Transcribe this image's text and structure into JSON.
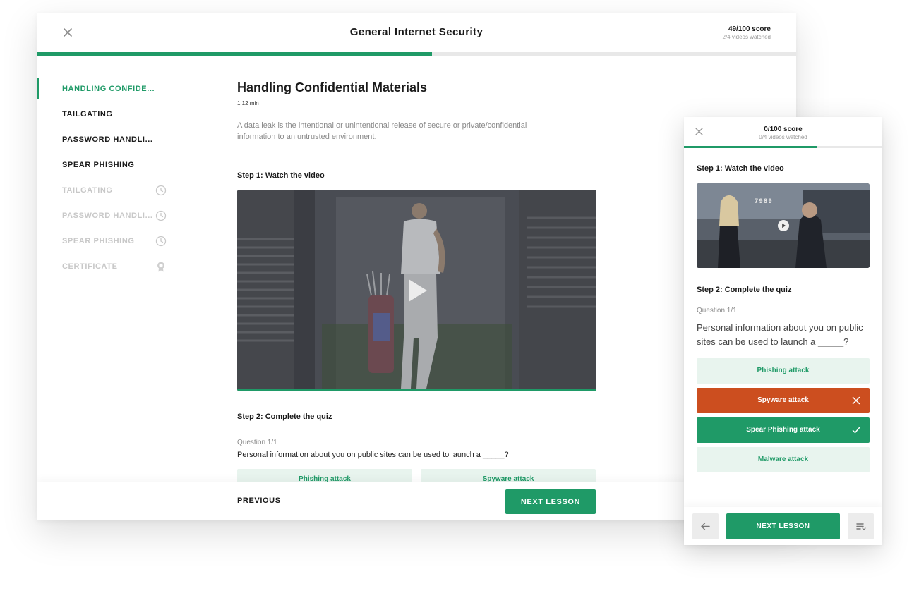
{
  "colors": {
    "accent": "#1f9a67",
    "accent_light": "#e8f4ee",
    "error": "#cc4e1f",
    "muted": "#c8c8c8"
  },
  "desktop": {
    "title": "General Internet Security",
    "close_icon": "close-icon",
    "score": "49/100 score",
    "videos_watched": "2/4 videos watched",
    "progress_fraction": 0.52,
    "sidebar": [
      {
        "label": "HANDLING CONFIDE...",
        "state": "active",
        "icon": ""
      },
      {
        "label": "TAILGATING",
        "state": "done",
        "icon": ""
      },
      {
        "label": "PASSWORD HANDLI...",
        "state": "done",
        "icon": ""
      },
      {
        "label": "SPEAR PHISHING",
        "state": "done",
        "icon": ""
      },
      {
        "label": "TAILGATING",
        "state": "locked",
        "icon": "clock-icon"
      },
      {
        "label": "PASSWORD HANDLI...",
        "state": "locked",
        "icon": "clock-icon"
      },
      {
        "label": "SPEAR PHISHING",
        "state": "locked",
        "icon": "clock-icon"
      },
      {
        "label": "CERTIFICATE",
        "state": "locked",
        "icon": "award-icon"
      }
    ],
    "lesson": {
      "title": "Handling Confidential Materials",
      "duration": "1:12 min",
      "description": "A data leak is the intentional or unintentional release of secure or private/confidential information to an untrusted environment.",
      "step1": "Step 1: Watch the video",
      "video_progress_fraction": 1.0,
      "step2": "Step 2: Complete the quiz",
      "question_num": "Question 1/1",
      "question": "Personal information about you on public sites can be used to launch a _____?",
      "answers_peek": [
        "Phishing attack",
        "Spyware attack"
      ]
    },
    "footer": {
      "previous": "PREVIOUS",
      "next": "NEXT LESSON"
    }
  },
  "mobile": {
    "close_icon": "close-icon",
    "score": "0/100 score",
    "videos_watched": "0/4 videos watched",
    "progress_fraction": 0.67,
    "step1": "Step 1: Watch the video",
    "video_sign": "7989",
    "step2": "Step 2: Complete the quiz",
    "question_num": "Question 1/1",
    "question": "Personal information about you on public sites can be used to launch a _____?",
    "answers": [
      {
        "label": "Phishing attack",
        "state": "neutral",
        "icon": ""
      },
      {
        "label": "Spyware attack",
        "state": "wrong",
        "icon": "x-icon"
      },
      {
        "label": "Spear Phishing attack",
        "state": "right",
        "icon": "check-icon"
      },
      {
        "label": "Malware attack",
        "state": "neutral",
        "icon": ""
      }
    ],
    "footer": {
      "back_icon": "arrow-left-icon",
      "next": "NEXT LESSON",
      "menu_icon": "playlist-icon"
    }
  }
}
